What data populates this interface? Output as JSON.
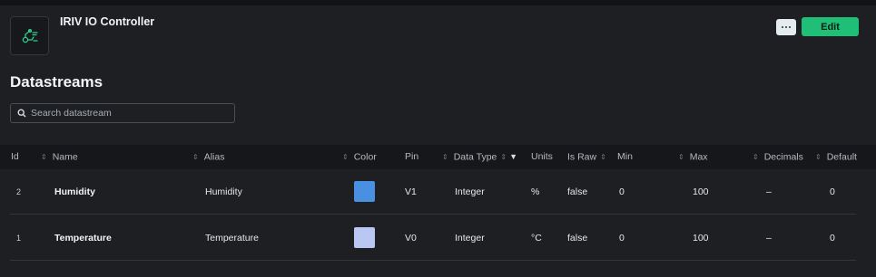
{
  "device": {
    "title": "IRIV IO Controller",
    "icon": "sensor-device-icon"
  },
  "header": {
    "more_label": "more-dots",
    "edit_label": "Edit"
  },
  "section": {
    "title": "Datastreams"
  },
  "search": {
    "placeholder": "Search datastream",
    "value": ""
  },
  "table": {
    "columns": [
      "Id",
      "Name",
      "Alias",
      "Color",
      "Pin",
      "Data Type",
      "Units",
      "Is Raw",
      "Min",
      "Max",
      "Decimals",
      "Default"
    ],
    "rows": [
      {
        "id": "2",
        "name": "Humidity",
        "alias": "Humidity",
        "color": "#4a90e2",
        "pin": "V1",
        "data_type": "Integer",
        "units": "%",
        "is_raw": "false",
        "min": "0",
        "max": "100",
        "decimals": "–",
        "default": "0"
      },
      {
        "id": "1",
        "name": "Temperature",
        "alias": "Temperature",
        "color": "#b9c8f2",
        "pin": "V0",
        "data_type": "Integer",
        "units": "°C",
        "is_raw": "false",
        "min": "0",
        "max": "100",
        "decimals": "–",
        "default": "0"
      }
    ]
  },
  "colors": {
    "accent": "#1fbf77",
    "background": "#1d1f23",
    "header_bg": "#16171a"
  }
}
